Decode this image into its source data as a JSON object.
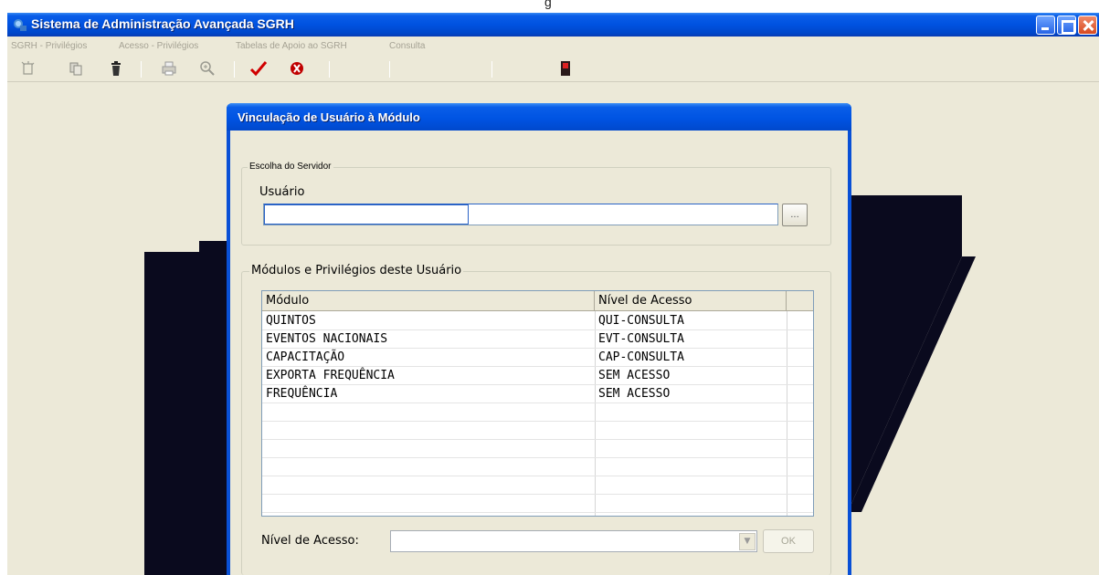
{
  "page_top_text": "g",
  "app": {
    "title": "Sistema de Administração Avançada SGRH"
  },
  "menu": {
    "items": [
      {
        "label": "SGRH - Privilégios"
      },
      {
        "label": "Acesso - Privilégios"
      },
      {
        "label": "Tabelas de Apoio ao SGRH"
      },
      {
        "label": "Consulta"
      }
    ]
  },
  "toolbar": {
    "icons": [
      "new-icon",
      "copy-icon",
      "trash-icon",
      "print-icon",
      "zoom-icon",
      "check-icon",
      "cancel-icon",
      "exit-icon"
    ],
    "accent_check": "#d00000",
    "accent_cancel": "#c00000"
  },
  "dialog": {
    "title": "Vinculação de Usuário à Módulo",
    "group_server": "Escolha do Servidor",
    "usuario_label": "Usuário",
    "usuario_value": "",
    "browse_label": "...",
    "group_modules": "Módulos e Privilégios deste Usuário",
    "columns": [
      "Módulo",
      "Nível de Acesso"
    ],
    "rows": [
      {
        "modulo": "QUINTOS",
        "nivel": "QUI-CONSULTA"
      },
      {
        "modulo": "EVENTOS NACIONAIS",
        "nivel": "EVT-CONSULTA"
      },
      {
        "modulo": "CAPACITAÇÃO",
        "nivel": "CAP-CONSULTA"
      },
      {
        "modulo": "EXPORTA FREQUÊNCIA",
        "nivel": "SEM ACESSO"
      },
      {
        "modulo": "FREQUÊNCIA",
        "nivel": "SEM ACESSO"
      }
    ],
    "nivel_label": "Nível de Acesso:",
    "nivel_value": "",
    "ok_label": "OK"
  },
  "colors": {
    "title_bar": "#0054e3",
    "window_bg": "#ece9d8",
    "logo": "#0a0a1e"
  }
}
